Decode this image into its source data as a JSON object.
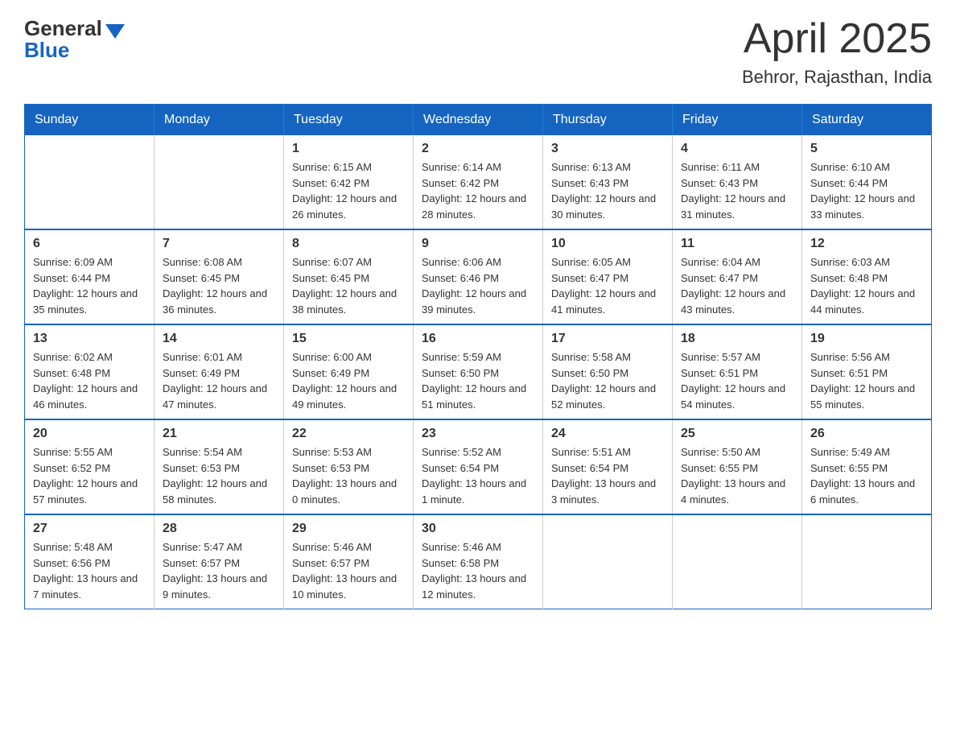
{
  "header": {
    "logo_general": "General",
    "logo_blue": "Blue",
    "month_title": "April 2025",
    "location": "Behror, Rajasthan, India"
  },
  "weekdays": [
    "Sunday",
    "Monday",
    "Tuesday",
    "Wednesday",
    "Thursday",
    "Friday",
    "Saturday"
  ],
  "weeks": [
    [
      {
        "day": "",
        "sunrise": "",
        "sunset": "",
        "daylight": ""
      },
      {
        "day": "",
        "sunrise": "",
        "sunset": "",
        "daylight": ""
      },
      {
        "day": "1",
        "sunrise": "Sunrise: 6:15 AM",
        "sunset": "Sunset: 6:42 PM",
        "daylight": "Daylight: 12 hours and 26 minutes."
      },
      {
        "day": "2",
        "sunrise": "Sunrise: 6:14 AM",
        "sunset": "Sunset: 6:42 PM",
        "daylight": "Daylight: 12 hours and 28 minutes."
      },
      {
        "day": "3",
        "sunrise": "Sunrise: 6:13 AM",
        "sunset": "Sunset: 6:43 PM",
        "daylight": "Daylight: 12 hours and 30 minutes."
      },
      {
        "day": "4",
        "sunrise": "Sunrise: 6:11 AM",
        "sunset": "Sunset: 6:43 PM",
        "daylight": "Daylight: 12 hours and 31 minutes."
      },
      {
        "day": "5",
        "sunrise": "Sunrise: 6:10 AM",
        "sunset": "Sunset: 6:44 PM",
        "daylight": "Daylight: 12 hours and 33 minutes."
      }
    ],
    [
      {
        "day": "6",
        "sunrise": "Sunrise: 6:09 AM",
        "sunset": "Sunset: 6:44 PM",
        "daylight": "Daylight: 12 hours and 35 minutes."
      },
      {
        "day": "7",
        "sunrise": "Sunrise: 6:08 AM",
        "sunset": "Sunset: 6:45 PM",
        "daylight": "Daylight: 12 hours and 36 minutes."
      },
      {
        "day": "8",
        "sunrise": "Sunrise: 6:07 AM",
        "sunset": "Sunset: 6:45 PM",
        "daylight": "Daylight: 12 hours and 38 minutes."
      },
      {
        "day": "9",
        "sunrise": "Sunrise: 6:06 AM",
        "sunset": "Sunset: 6:46 PM",
        "daylight": "Daylight: 12 hours and 39 minutes."
      },
      {
        "day": "10",
        "sunrise": "Sunrise: 6:05 AM",
        "sunset": "Sunset: 6:47 PM",
        "daylight": "Daylight: 12 hours and 41 minutes."
      },
      {
        "day": "11",
        "sunrise": "Sunrise: 6:04 AM",
        "sunset": "Sunset: 6:47 PM",
        "daylight": "Daylight: 12 hours and 43 minutes."
      },
      {
        "day": "12",
        "sunrise": "Sunrise: 6:03 AM",
        "sunset": "Sunset: 6:48 PM",
        "daylight": "Daylight: 12 hours and 44 minutes."
      }
    ],
    [
      {
        "day": "13",
        "sunrise": "Sunrise: 6:02 AM",
        "sunset": "Sunset: 6:48 PM",
        "daylight": "Daylight: 12 hours and 46 minutes."
      },
      {
        "day": "14",
        "sunrise": "Sunrise: 6:01 AM",
        "sunset": "Sunset: 6:49 PM",
        "daylight": "Daylight: 12 hours and 47 minutes."
      },
      {
        "day": "15",
        "sunrise": "Sunrise: 6:00 AM",
        "sunset": "Sunset: 6:49 PM",
        "daylight": "Daylight: 12 hours and 49 minutes."
      },
      {
        "day": "16",
        "sunrise": "Sunrise: 5:59 AM",
        "sunset": "Sunset: 6:50 PM",
        "daylight": "Daylight: 12 hours and 51 minutes."
      },
      {
        "day": "17",
        "sunrise": "Sunrise: 5:58 AM",
        "sunset": "Sunset: 6:50 PM",
        "daylight": "Daylight: 12 hours and 52 minutes."
      },
      {
        "day": "18",
        "sunrise": "Sunrise: 5:57 AM",
        "sunset": "Sunset: 6:51 PM",
        "daylight": "Daylight: 12 hours and 54 minutes."
      },
      {
        "day": "19",
        "sunrise": "Sunrise: 5:56 AM",
        "sunset": "Sunset: 6:51 PM",
        "daylight": "Daylight: 12 hours and 55 minutes."
      }
    ],
    [
      {
        "day": "20",
        "sunrise": "Sunrise: 5:55 AM",
        "sunset": "Sunset: 6:52 PM",
        "daylight": "Daylight: 12 hours and 57 minutes."
      },
      {
        "day": "21",
        "sunrise": "Sunrise: 5:54 AM",
        "sunset": "Sunset: 6:53 PM",
        "daylight": "Daylight: 12 hours and 58 minutes."
      },
      {
        "day": "22",
        "sunrise": "Sunrise: 5:53 AM",
        "sunset": "Sunset: 6:53 PM",
        "daylight": "Daylight: 13 hours and 0 minutes."
      },
      {
        "day": "23",
        "sunrise": "Sunrise: 5:52 AM",
        "sunset": "Sunset: 6:54 PM",
        "daylight": "Daylight: 13 hours and 1 minute."
      },
      {
        "day": "24",
        "sunrise": "Sunrise: 5:51 AM",
        "sunset": "Sunset: 6:54 PM",
        "daylight": "Daylight: 13 hours and 3 minutes."
      },
      {
        "day": "25",
        "sunrise": "Sunrise: 5:50 AM",
        "sunset": "Sunset: 6:55 PM",
        "daylight": "Daylight: 13 hours and 4 minutes."
      },
      {
        "day": "26",
        "sunrise": "Sunrise: 5:49 AM",
        "sunset": "Sunset: 6:55 PM",
        "daylight": "Daylight: 13 hours and 6 minutes."
      }
    ],
    [
      {
        "day": "27",
        "sunrise": "Sunrise: 5:48 AM",
        "sunset": "Sunset: 6:56 PM",
        "daylight": "Daylight: 13 hours and 7 minutes."
      },
      {
        "day": "28",
        "sunrise": "Sunrise: 5:47 AM",
        "sunset": "Sunset: 6:57 PM",
        "daylight": "Daylight: 13 hours and 9 minutes."
      },
      {
        "day": "29",
        "sunrise": "Sunrise: 5:46 AM",
        "sunset": "Sunset: 6:57 PM",
        "daylight": "Daylight: 13 hours and 10 minutes."
      },
      {
        "day": "30",
        "sunrise": "Sunrise: 5:46 AM",
        "sunset": "Sunset: 6:58 PM",
        "daylight": "Daylight: 13 hours and 12 minutes."
      },
      {
        "day": "",
        "sunrise": "",
        "sunset": "",
        "daylight": ""
      },
      {
        "day": "",
        "sunrise": "",
        "sunset": "",
        "daylight": ""
      },
      {
        "day": "",
        "sunrise": "",
        "sunset": "",
        "daylight": ""
      }
    ]
  ]
}
